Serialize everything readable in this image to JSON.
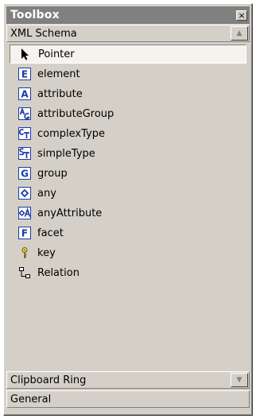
{
  "window": {
    "title": "Toolbox",
    "close_glyph": "×"
  },
  "tabs": [
    {
      "label": "XML Schema",
      "scroll_glyph": "▲"
    },
    {
      "label": "Clipboard Ring",
      "scroll_glyph": "▼"
    },
    {
      "label": "General"
    }
  ],
  "items": [
    {
      "label": "Pointer",
      "icon": "pointer-icon"
    },
    {
      "label": "element",
      "icon": "element-icon"
    },
    {
      "label": "attribute",
      "icon": "attribute-icon"
    },
    {
      "label": "attributeGroup",
      "icon": "attribute-group-icon"
    },
    {
      "label": "complexType",
      "icon": "complex-type-icon"
    },
    {
      "label": "simpleType",
      "icon": "simple-type-icon"
    },
    {
      "label": "group",
      "icon": "group-icon"
    },
    {
      "label": "any",
      "icon": "any-icon"
    },
    {
      "label": "anyAttribute",
      "icon": "any-attribute-icon"
    },
    {
      "label": "facet",
      "icon": "facet-icon"
    },
    {
      "label": "key",
      "icon": "key-icon"
    },
    {
      "label": "Relation",
      "icon": "relation-icon"
    }
  ],
  "icon_letters": {
    "element": "E",
    "attribute": "A",
    "group": "G",
    "facet": "F"
  },
  "colors": {
    "face": "#d4d0c8",
    "titlebar": "#808080",
    "icon_blue": "#1c3aa8",
    "selected_bg": "#f6f3ee"
  }
}
